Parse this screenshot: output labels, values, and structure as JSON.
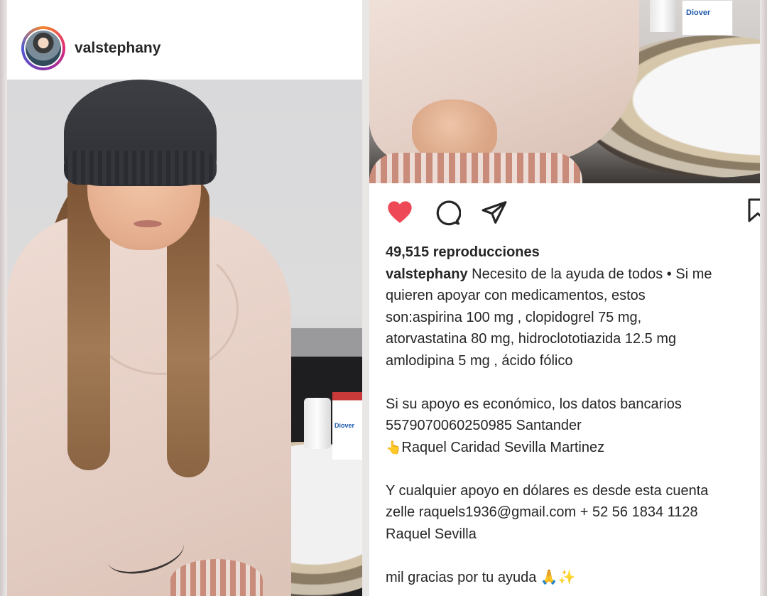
{
  "left_post": {
    "username": "valstephany",
    "medicine_box_text": "Diover"
  },
  "right_post": {
    "medicine_box_text": "Diover",
    "views": "49,515 reproducciones",
    "caption": {
      "username": "valstephany",
      "lines": [
        "Necesito de la ayuda de todos • Si me",
        "quieren apoyar con medicamentos, estos",
        "son:aspirina 100 mg , clopidogrel 75 mg,",
        "atorvastatina 80 mg, hidroclototiazida 12.5 mg",
        "amlodipina 5 mg , ácido fólico",
        "Si su apoyo es económico, los datos bancarios",
        "5579070060250985 Santander",
        "Raquel Caridad Sevilla Martinez",
        "Y cualquier apoyo en dólares es desde esta cuenta",
        "zelle raquels1936@gmail.com + 52 56 1834 1128",
        "Raquel Sevilla",
        "mil gracias por tu ayuda"
      ],
      "emoji": {
        "point": "👆",
        "pray": "🙏",
        "sparkle": "✨"
      }
    },
    "icons": {
      "like": "heart-icon",
      "comment": "comment-icon",
      "share": "share-icon",
      "save": "bookmark-icon"
    },
    "colors": {
      "like_red": "#ed4956",
      "text": "#262626"
    }
  }
}
